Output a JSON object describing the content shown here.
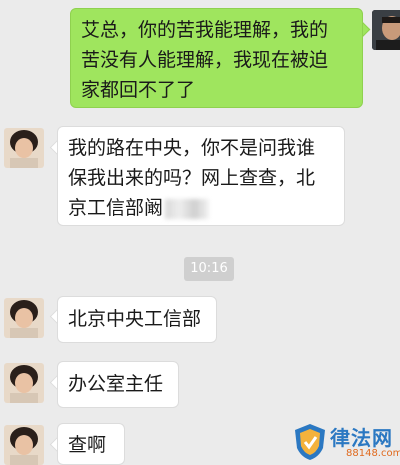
{
  "messages": [
    {
      "side": "out",
      "text_lines": [
        "艾总，你的苦我能理解，我的",
        "苦没有人能理解，我现在被迫",
        "家都回不了了"
      ]
    },
    {
      "side": "in",
      "text_lines": [
        "我的路在中央，你不是问我谁",
        "保我出来的吗？网上查查，北",
        "京工信部阚"
      ]
    },
    {
      "side": "in",
      "text": "北京中央工信部"
    },
    {
      "side": "in",
      "text": "办公室主任"
    },
    {
      "side": "in",
      "text": "查啊"
    }
  ],
  "timestamp": "10:16",
  "watermark": {
    "title": "律法网",
    "sub": "88148.com"
  }
}
